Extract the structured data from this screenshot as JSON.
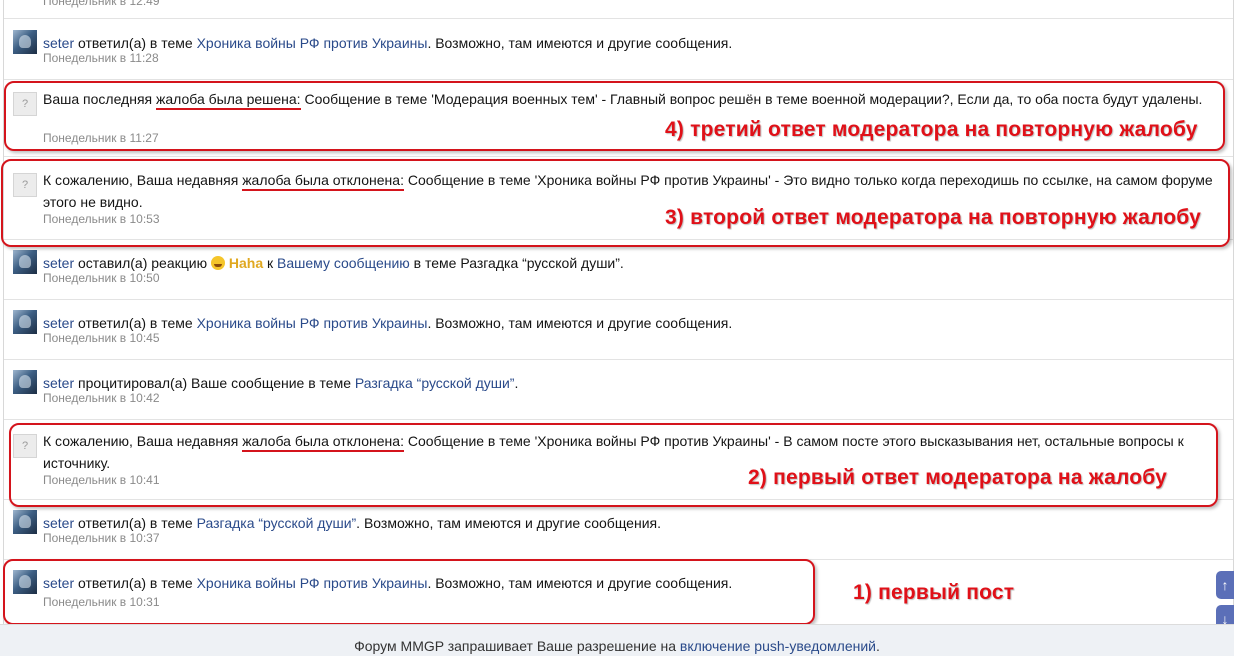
{
  "top_time": "Понедельник в 12:49",
  "items": [
    {
      "user": "seter",
      "action": "ответил(а) в теме",
      "link": "Хроника войны РФ против Украины",
      "rest": ". Возможно, там имеются и другие сообщения.",
      "time": "Понедельник в 11:28"
    },
    {
      "pre": "Ваша последняя",
      "under": "жалоба была решена:",
      "post": "Сообщение в теме 'Модерация военных тем' - Главный вопрос решён в теме военной модерации?, Если да, то оба поста будут удалены.",
      "time": "Понедельник в 11:27"
    },
    {
      "pre": "К сожалению, Ваша недавняя",
      "under": "жалоба была отклонена:",
      "post": "Сообщение в теме 'Хроника войны РФ против Украины' - Это видно только когда переходишь по ссылке, на самом форуме этого не видно.",
      "time": "Понедельник в 10:53"
    },
    {
      "user": "seter",
      "action": "оставил(а) реакцию",
      "reaction": "Haha",
      "to": "к",
      "link": "Вашему сообщению",
      "rest": "в теме Разгадка “русской души”.",
      "time": "Понедельник в 10:50"
    },
    {
      "user": "seter",
      "action": "ответил(а) в теме",
      "link": "Хроника войны РФ против Украины",
      "rest": ". Возможно, там имеются и другие сообщения.",
      "time": "Понедельник в 10:45"
    },
    {
      "user": "seter",
      "action": "процитировал(а) Ваше сообщение в теме",
      "link": "Разгадка “русской души”",
      "rest": ".",
      "time": "Понедельник в 10:42"
    },
    {
      "pre": "К сожалению, Ваша недавняя",
      "under": "жалоба была отклонена:",
      "post": "Сообщение в теме 'Хроника войны РФ против Украины' - В самом посте этого высказывания нет, остальные вопросы к источнику.",
      "time": "Понедельник в 10:41"
    },
    {
      "user": "seter",
      "action": "ответил(а) в теме",
      "link": "Разгадка “русской души”",
      "rest": ". Возможно, там имеются и другие сообщения.",
      "time": "Понедельник в 10:37"
    },
    {
      "user": "seter",
      "action": "ответил(а) в теме",
      "link": "Хроника войны РФ против Украины",
      "rest": ". Возможно, там имеются и другие сообщения.",
      "time": "Понедельник в 10:31"
    }
  ],
  "annotations": {
    "a4": "4) третий ответ модератора на повторную жалобу",
    "a3": "3) второй ответ модератора на повторную жалобу",
    "a2": "2) первый ответ модератора на жалобу",
    "a1": "1) первый пост"
  },
  "system_avatar_glyph": "?",
  "push_bar": {
    "text": "Форум MMGP запрашивает Ваше разрешение на",
    "link": "включение push-уведомлений",
    "end": "."
  },
  "scroll": {
    "up": "↑",
    "down": "↓"
  },
  "colors": {
    "annotation_red": "#d4141c",
    "link_blue": "#2a4a8a",
    "haha_gold": "#e0a821"
  }
}
